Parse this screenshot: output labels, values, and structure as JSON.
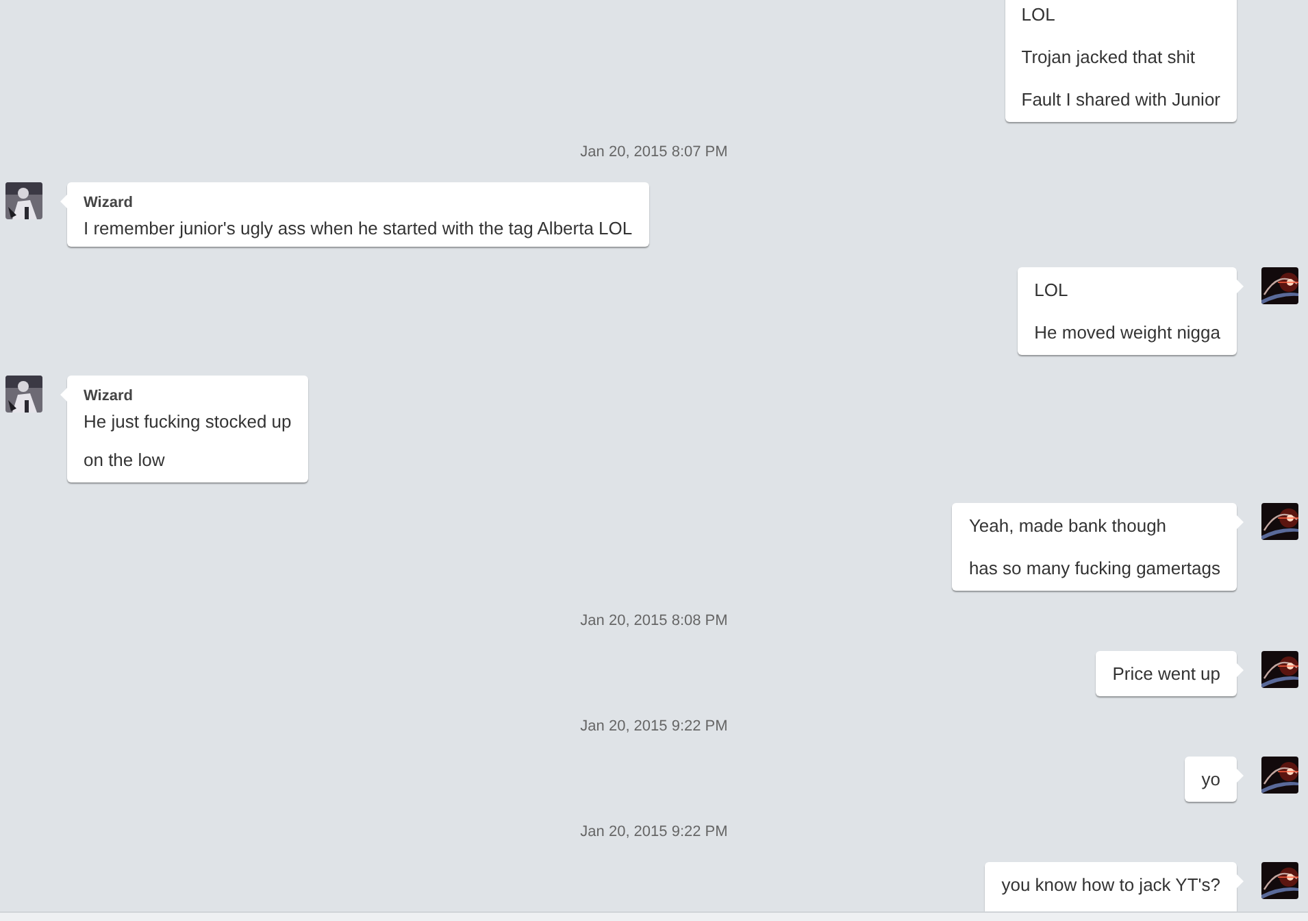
{
  "messages": [
    {
      "kind": "message",
      "outgoing": true,
      "avatar": false,
      "cut_top": true,
      "cut_bottom": false,
      "lines": [
        "LOL",
        "Trojan jacked that shit",
        "Fault I shared with Junior"
      ]
    },
    {
      "kind": "timestamp",
      "text": "Jan 20, 2015 8:07 PM"
    },
    {
      "kind": "message",
      "outgoing": false,
      "avatar": true,
      "cut_top": false,
      "cut_bottom": false,
      "sender": "Wizard",
      "lines": [
        "I remember junior's ugly ass when he started with the tag Alberta LOL"
      ]
    },
    {
      "kind": "message",
      "outgoing": true,
      "avatar": true,
      "cut_top": false,
      "cut_bottom": false,
      "lines": [
        "LOL",
        "He moved weight nigga"
      ]
    },
    {
      "kind": "message",
      "outgoing": false,
      "avatar": true,
      "cut_top": false,
      "cut_bottom": false,
      "sender": "Wizard",
      "lines": [
        "He just fucking stocked up",
        "on the low"
      ]
    },
    {
      "kind": "message",
      "outgoing": true,
      "avatar": true,
      "cut_top": false,
      "cut_bottom": false,
      "lines": [
        "Yeah, made bank though",
        "has so many fucking gamertags"
      ]
    },
    {
      "kind": "timestamp",
      "text": "Jan 20, 2015 8:08 PM"
    },
    {
      "kind": "message",
      "outgoing": true,
      "avatar": true,
      "cut_top": false,
      "cut_bottom": false,
      "lines": [
        "Price went up"
      ]
    },
    {
      "kind": "timestamp",
      "text": "Jan 20, 2015 9:22 PM"
    },
    {
      "kind": "message",
      "outgoing": true,
      "avatar": true,
      "cut_top": false,
      "cut_bottom": false,
      "lines": [
        "yo"
      ]
    },
    {
      "kind": "timestamp",
      "text": "Jan 20, 2015 9:22 PM"
    },
    {
      "kind": "message",
      "outgoing": true,
      "avatar": true,
      "cut_top": false,
      "cut_bottom": true,
      "lines": [
        "you know how to jack YT's?"
      ]
    }
  ]
}
